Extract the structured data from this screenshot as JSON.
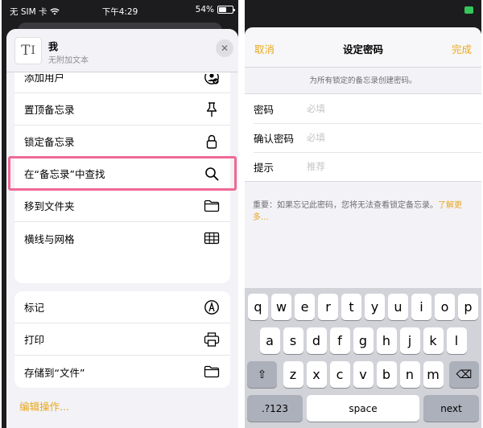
{
  "left": {
    "status": {
      "carrier": "无 SIM 卡",
      "time": "下午4:29",
      "battery": "54%"
    },
    "header": {
      "thumb_glyph": "T",
      "title": "我",
      "subtitle": "无附加文本",
      "close_glyph": "✕"
    },
    "partial_row_label": "打印",
    "menu_group1": [
      {
        "label": "添加用户",
        "icon": "add-person-icon"
      },
      {
        "label": "置顶备忘录",
        "icon": "pin-icon"
      },
      {
        "label": "锁定备忘录",
        "icon": "lock-icon",
        "highlighted": true
      },
      {
        "label": "在“备忘录”中查找",
        "icon": "search-icon"
      },
      {
        "label": "移到文件夹",
        "icon": "folder-icon"
      },
      {
        "label": "横线与网格",
        "icon": "grid-icon"
      }
    ],
    "menu_group2": [
      {
        "label": "标记",
        "icon": "markup-icon"
      },
      {
        "label": "打印",
        "icon": "printer-icon"
      },
      {
        "label": "存储到“文件”",
        "icon": "folder-icon"
      }
    ],
    "edit_actions": "编辑操作..."
  },
  "right": {
    "nav": {
      "cancel": "取消",
      "title": "设定密码",
      "done": "完成"
    },
    "hint": "为所有锁定的备忘录创建密码。",
    "fields": [
      {
        "label": "密码",
        "placeholder": "必填"
      },
      {
        "label": "确认密码",
        "placeholder": "必填"
      },
      {
        "label": "提示",
        "placeholder": "推荐"
      }
    ],
    "note": {
      "text": "重要：如果忘记此密码，您将无法查看锁定备忘录。",
      "link": "了解更多..."
    },
    "keyboard": {
      "row1": [
        "q",
        "w",
        "e",
        "r",
        "t",
        "y",
        "u",
        "i",
        "o",
        "p"
      ],
      "row2": [
        "a",
        "s",
        "d",
        "f",
        "g",
        "h",
        "j",
        "k",
        "l"
      ],
      "row3": [
        "z",
        "x",
        "c",
        "v",
        "b",
        "n",
        "m"
      ],
      "shift_glyph": "⇧",
      "delete_glyph": "⌫",
      "numbers": ".?123",
      "space": "space",
      "next": "next"
    }
  },
  "colors": {
    "accent": "#e9a81d",
    "highlight": "#ee6a94",
    "sheet_bg": "#f2f2f7",
    "dark_bg": "#1c1c1e"
  }
}
